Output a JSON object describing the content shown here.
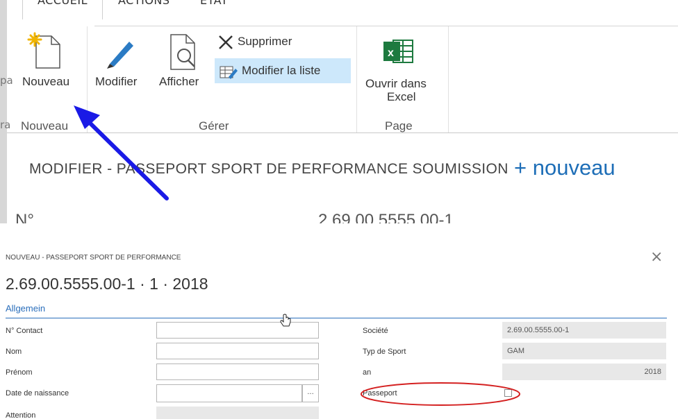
{
  "ribbon": {
    "tabs": [
      "ACCUEIL",
      "ACTIONS",
      "ETAT"
    ],
    "left_fragments": [
      "pa",
      "ra"
    ],
    "buttons": {
      "nouveau": "Nouveau",
      "modifier": "Modifier",
      "afficher": "Afficher",
      "supprimer": "Supprimer",
      "modifier_liste": "Modifier la liste",
      "ouvrir_excel_line1": "Ouvrir dans",
      "ouvrir_excel_line2": "Excel"
    },
    "groups": [
      "Nouveau",
      "Gérer",
      "Page"
    ]
  },
  "page": {
    "heading": "MODIFIER - PASSEPORT SPORT DE PERFORMANCE SOUMISSION",
    "new_link": "+ nouveau",
    "number_label": "N°",
    "number_value": "2.69.00.5555.00-1"
  },
  "dialog": {
    "caption": "NOUVEAU - PASSEPORT SPORT DE PERFORMANCE",
    "close_glyph": "×",
    "title": "2.69.00.5555.00-1 · 1 · 2018",
    "section": "Allgemein",
    "left_fields": [
      {
        "label": "N° Contact",
        "value": ""
      },
      {
        "label": "Nom",
        "value": ""
      },
      {
        "label": "Prénom",
        "value": ""
      },
      {
        "label": "Date de naissance",
        "value": ""
      },
      {
        "label": "Attention",
        "value": ""
      }
    ],
    "lookup_glyph": "...",
    "right_fields": [
      {
        "label": "Société",
        "value": "2.69.00.5555.00-1"
      },
      {
        "label": "Typ de Sport",
        "value": "GAM"
      },
      {
        "label": "an",
        "value": "2018"
      },
      {
        "label": "Passeport",
        "checked": false
      }
    ]
  },
  "colors": {
    "accent_blue": "#1e6eb7",
    "arrow_blue": "#1a1ae6",
    "highlight_red": "#d42020",
    "selected_button": "#cde8fb",
    "excel_green": "#1d7a3f"
  },
  "icons": [
    "new-document-icon",
    "pencil-icon",
    "magnifier-document-icon",
    "delete-x-icon",
    "edit-list-icon",
    "excel-icon",
    "close-icon",
    "hand-cursor-icon"
  ]
}
